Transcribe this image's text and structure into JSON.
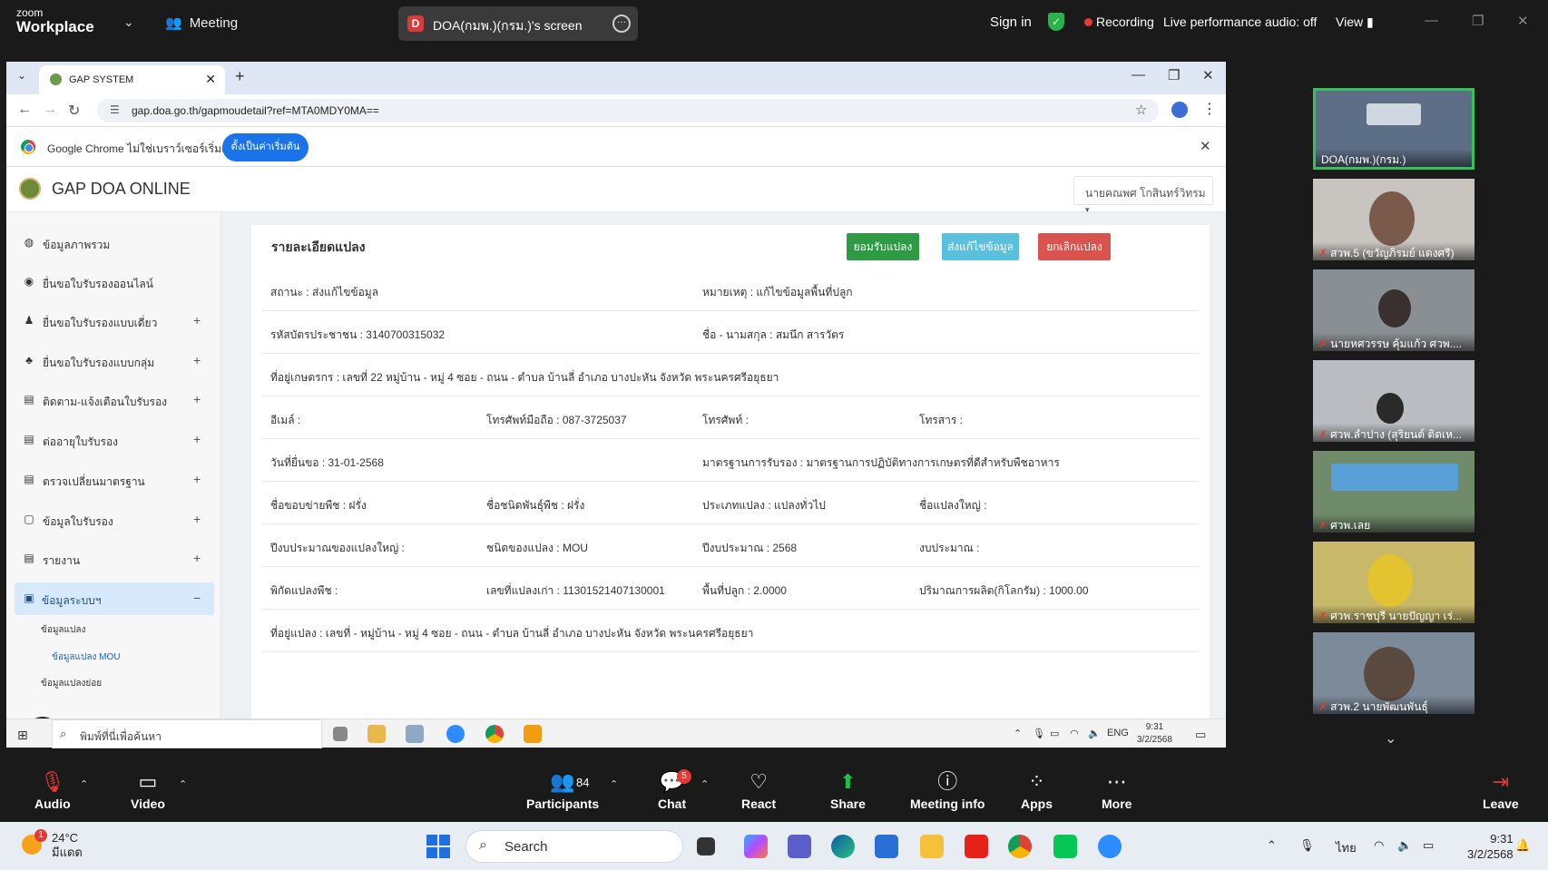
{
  "zoom_top": {
    "logo_small": "zoom",
    "logo_big": "Workplace",
    "meeting_label": "Meeting",
    "share_initial": "D",
    "share_title": "DOA(กมพ.)(กรม.)'s screen",
    "sign_in": "Sign in",
    "recording": "Recording",
    "audio_status": "Live performance audio: off",
    "view": "View"
  },
  "browser": {
    "tab_title": "GAP SYSTEM",
    "url": "gap.doa.go.th/gapmoudetail?ref=MTA0MDY0MA==",
    "info_text": "Google Chrome ไม่ใช่เบราว์เซอร์เริ่มต้น",
    "info_button": "ตั้งเป็นค่าเริ่มต้น"
  },
  "app": {
    "name": "GAP DOA ONLINE",
    "user": "นายคณพศ โกสินทร์วิทรม"
  },
  "sidebar": {
    "items": [
      {
        "icon": "◍",
        "label": "ข้อมูลภาพรวม",
        "plus": ""
      },
      {
        "icon": "◉",
        "label": "ยื่นขอใบรับรองออนไลน์",
        "plus": ""
      },
      {
        "icon": "♟",
        "label": "ยื่นขอใบรับรองแบบเดี่ยว",
        "plus": "+"
      },
      {
        "icon": "♣",
        "label": "ยื่นขอใบรับรองแบบกลุ่ม",
        "plus": "+"
      },
      {
        "icon": "▤",
        "label": "ติดตาม-แจ้งเตือนใบรับรอง",
        "plus": "+"
      },
      {
        "icon": "▤",
        "label": "ต่ออายุใบรับรอง",
        "plus": "+"
      },
      {
        "icon": "▤",
        "label": "ตรวจเปลี่ยนมาตรฐาน",
        "plus": "+"
      },
      {
        "icon": "▢",
        "label": "ข้อมูลใบรับรอง",
        "plus": "+"
      },
      {
        "icon": "▤",
        "label": "รายงาน",
        "plus": "+"
      },
      {
        "icon": "▣",
        "label": "ข้อมูลระบบฯ",
        "plus": "−"
      }
    ],
    "sub_items": [
      "ข้อมูลแปลง",
      "ข้อมูลแปลง MOU",
      "ข้อมูลแปลงย่อย"
    ]
  },
  "detail": {
    "title": "รายละเอียดแปลง",
    "btn_accept": "ยอมรับแปลง",
    "btn_edit": "ส่งแก้ไขข้อมูล",
    "btn_cancel": "ยกเลิกแปลง",
    "rows": [
      [
        "สถานะ : ส่งแก้ไขข้อมูล",
        "หมายเหตุ : แก้ไขข้อมูลพื้นที่ปลูก"
      ],
      [
        "รหัสบัตรประชาชน : 3140700315032",
        "ชื่อ - นามสกุล : สมนึก สารวัตร"
      ],
      [
        "ที่อยู่เกษตรกร : เลขที่ 22 หมู่บ้าน - หมู่ 4 ซอย - ถนน - ตำบล บ้านลี่ อำเภอ บางปะหัน จังหวัด พระนครศรีอยุธยา"
      ],
      [
        "อีเมล์ :",
        "โทรศัพท์มือถือ : 087-3725037",
        "โทรศัพท์ :",
        "โทรสาร :"
      ],
      [
        "วันที่ยื่นขอ : 31-01-2568",
        "มาตรฐานการรับรอง : มาตรฐานการปฏิบัติทางการเกษตรที่ดีสำหรับพืชอาหาร"
      ],
      [
        "ชื่อขอบข่ายพืช : ฝรั่ง",
        "ชื่อชนิดพันธุ์พืช : ฝรั่ง",
        "ประเภทแปลง : แปลงทั่วไป",
        "ชื่อแปลงใหญ่ :"
      ],
      [
        "ปีงบประมาณของแปลงใหญ่ :",
        "ชนิดของแปลง : MOU",
        "ปีงบประมาณ : 2568",
        "งบประมาณ :"
      ],
      [
        "พิกัดแปลงพืช :",
        "เลขที่แปลงเก่า : 11301521407130001",
        "พื้นที่ปลูก : 2.0000",
        "ปริมาณการผลิต(กิโลกรัม) : 1000.00"
      ],
      [
        "ที่อยู่แปลง : เลขที่ - หมู่บ้าน - หมู่ 4 ซอย - ถนน - ตำบล บ้านลี่ อำเภอ บางปะหัน จังหวัด พระนครศรีอยุธยา"
      ]
    ]
  },
  "participants": [
    {
      "name": "DOA(กมพ.)(กรม.)",
      "bg": "#5d6f86"
    },
    {
      "name": "สวพ.5 (ขวัญภิรมย์ แดงศรี)",
      "bg": "#c8c4c0"
    },
    {
      "name": "นายหศวรรษ คุ้มแก้ว ศวพ....",
      "bg": "#8a8f93"
    },
    {
      "name": "ศวพ.ลำปาง (สุริยนต์ ติดเห...",
      "bg": "#b9bcc0"
    },
    {
      "name": "ศวพ.เลย",
      "bg": "#6f8b6a"
    },
    {
      "name": "ศวพ.ราชบุรี นายปัญญา เร่...",
      "bg": "#c7b86a"
    },
    {
      "name": "สวพ.2 นายพัฒนพันธุ์",
      "bg": "#7d8a99"
    }
  ],
  "win_inner": {
    "search_placeholder": "พิมพ์ที่นี่เพื่อค้นหา",
    "lang": "ENG",
    "time": "9:31",
    "date": "3/2/2568"
  },
  "zoom_bar": {
    "audio": "Audio",
    "video": "Video",
    "participants": "Participants",
    "participant_count": "84",
    "chat": "Chat",
    "chat_badge": "5",
    "react": "React",
    "share": "Share",
    "meeting_info": "Meeting info",
    "apps": "Apps",
    "more": "More",
    "leave": "Leave"
  },
  "taskbar": {
    "notif_count": "1",
    "temp": "24°C",
    "weather": "มีแดด",
    "search": "Search",
    "lang": "ไทย",
    "time": "9:31",
    "date": "3/2/2568"
  }
}
